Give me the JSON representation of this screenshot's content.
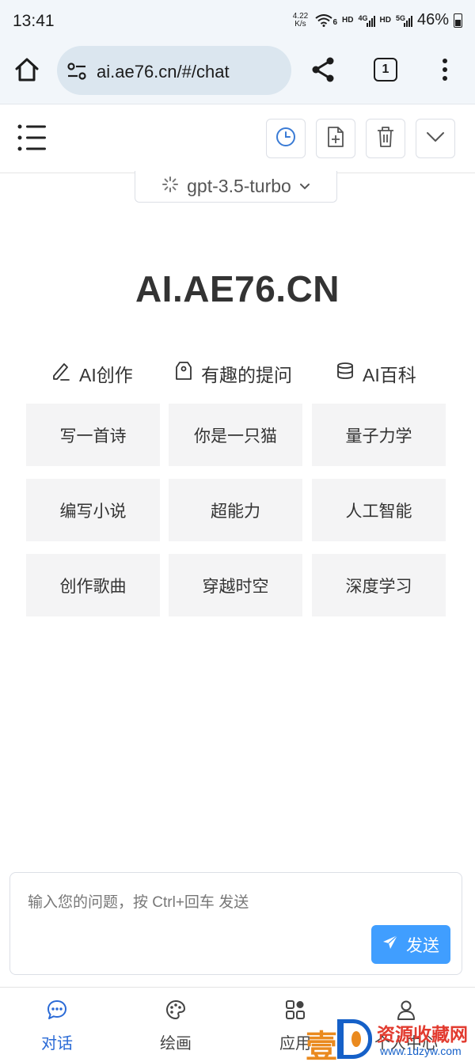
{
  "status_bar": {
    "time": "13:41",
    "net_speed_value": "4.22",
    "net_speed_unit": "K/s",
    "wifi_label": "6",
    "hd1": "HD",
    "signal1": "4G",
    "hd2": "HD",
    "signal2": "5G",
    "battery": "46%"
  },
  "browser": {
    "url": "ai.ae76.cn/#/chat",
    "tab_count": "1"
  },
  "model": {
    "name": "gpt-3.5-turbo"
  },
  "brand": {
    "title": "AI.AE76.CN"
  },
  "categories": [
    {
      "label": "AI创作",
      "icon": "pencil-icon",
      "items": [
        "写一首诗",
        "编写小说",
        "创作歌曲"
      ]
    },
    {
      "label": "有趣的提问",
      "icon": "tag-icon",
      "items": [
        "你是一只猫",
        "超能力",
        "穿越时空"
      ]
    },
    {
      "label": "AI百科",
      "icon": "database-icon",
      "items": [
        "量子力学",
        "人工智能",
        "深度学习"
      ]
    }
  ],
  "composer": {
    "placeholder": "输入您的问题，按 Ctrl+回车 发送",
    "send_label": "发送"
  },
  "bottom_nav": [
    {
      "label": "对话",
      "icon": "chat-bubble-icon",
      "active": true
    },
    {
      "label": "绘画",
      "icon": "palette-icon",
      "active": false
    },
    {
      "label": "应用",
      "icon": "apps-grid-icon",
      "active": false
    },
    {
      "label": "个人中心",
      "icon": "user-icon",
      "active": false
    }
  ],
  "watermark": {
    "char": "壹",
    "main": "资源收藏网",
    "url": "www.1dzyw.com"
  },
  "colors": {
    "accent": "#409eff",
    "nav_active": "#2a6ad6",
    "card_bg": "#f4f4f5",
    "browser_bg": "#f2f6fa"
  }
}
